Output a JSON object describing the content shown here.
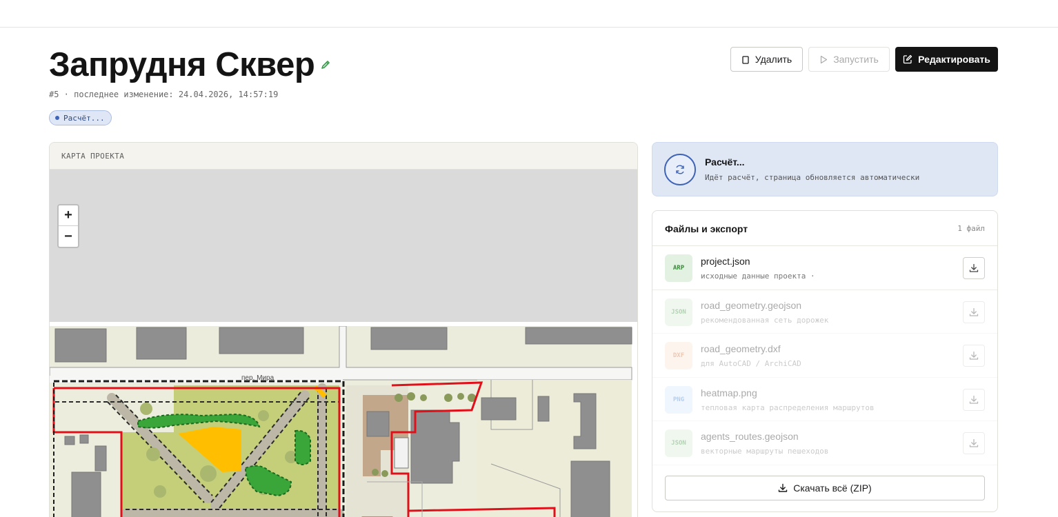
{
  "header": {
    "title": "Запрудня Сквер",
    "meta": "#5 · последнее изменение: 24.04.2026, 14:57:19",
    "status_pill": "Расчёт..."
  },
  "actions": {
    "delete_label": "Удалить",
    "run_label": "Запустить",
    "edit_label": "Редактировать"
  },
  "map": {
    "header": "КАРТА ПРОЕКТА",
    "zoom_in": "+",
    "zoom_out": "−",
    "street_label": "пер. Мира"
  },
  "calc": {
    "title": "Расчёт...",
    "subtitle": "Идёт расчёт, страница обновляется автоматически"
  },
  "files": {
    "title": "Файлы и экспорт",
    "count": "1 файл",
    "items": [
      {
        "badge": "ARP",
        "name": "project.json",
        "desc": "исходные данные проекта ·",
        "badge_bg": "#e3f1e3",
        "badge_fg": "#3a8a3a",
        "enabled": true
      },
      {
        "badge": "JSON",
        "name": "road_geometry.geojson",
        "desc": "рекомендованная сеть дорожек",
        "badge_bg": "#d6ecd6",
        "badge_fg": "#3a8a3a",
        "enabled": false
      },
      {
        "badge": "DXF",
        "name": "road_geometry.dxf",
        "desc": "для AutoCAD / ArchiCAD",
        "badge_bg": "#fbe3d4",
        "badge_fg": "#d0703a",
        "enabled": false
      },
      {
        "badge": "PNG",
        "name": "heatmap.png",
        "desc": "тепловая карта распределения маршрутов",
        "badge_bg": "#d8e8fb",
        "badge_fg": "#3f7fd0",
        "enabled": false
      },
      {
        "badge": "JSON",
        "name": "agents_routes.geojson",
        "desc": "векторные маршруты пешеходов",
        "badge_bg": "#d6ecd6",
        "badge_fg": "#3a8a3a",
        "enabled": false
      }
    ],
    "zip_label": "Скачать всё (ZIP)"
  },
  "colors": {
    "accent_blue": "#3f63b5",
    "primary_button": "#141414",
    "boundary_red": "#e0101a"
  }
}
